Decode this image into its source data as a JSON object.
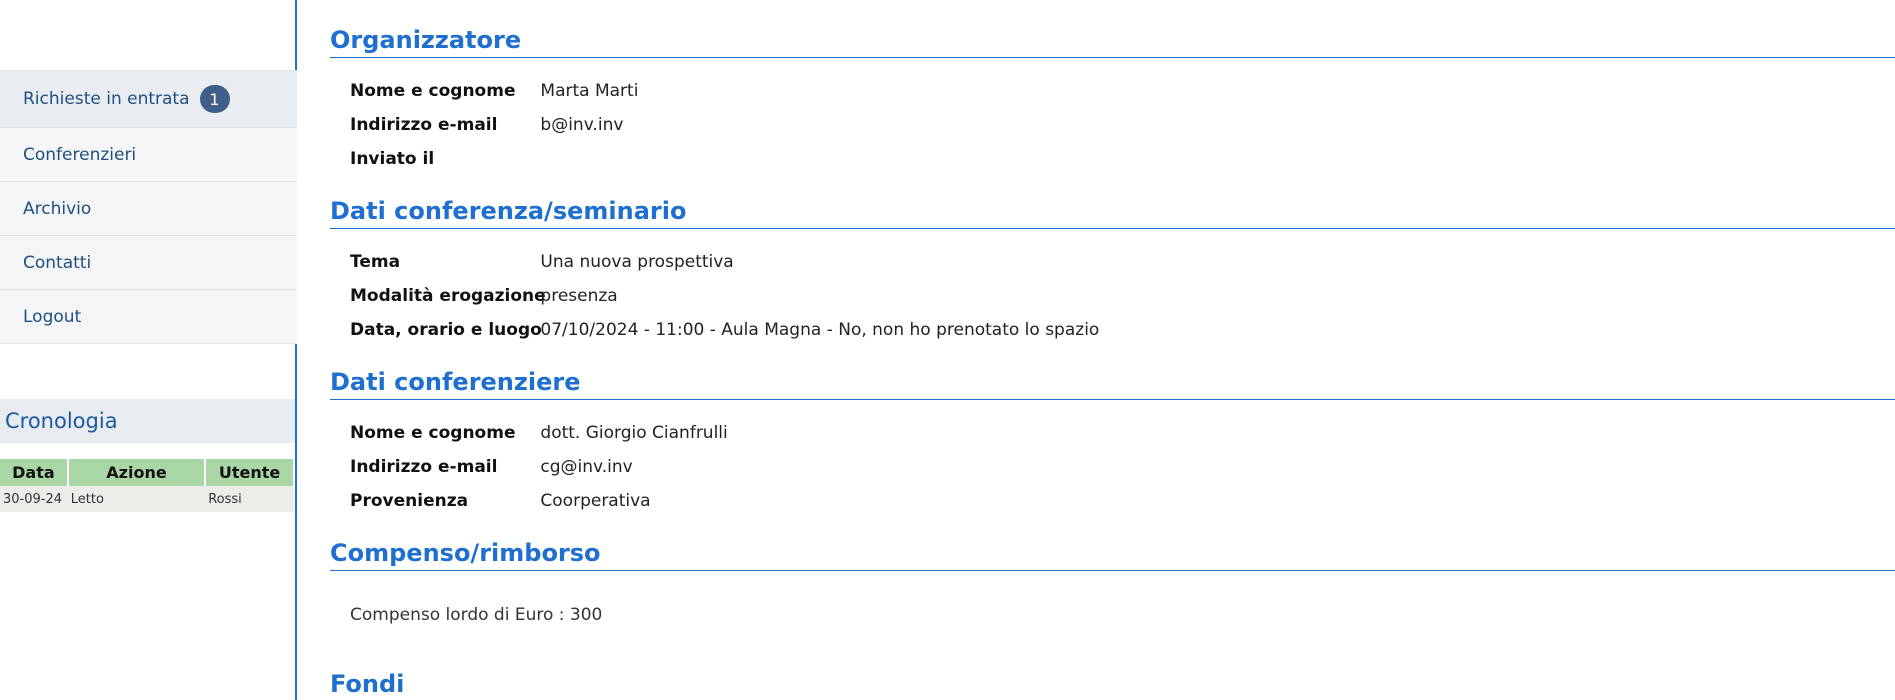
{
  "sidebar": {
    "nav": [
      {
        "label": "Richieste in entrata",
        "badge": "1"
      },
      {
        "label": "Conferenzieri"
      },
      {
        "label": "Archivio"
      },
      {
        "label": "Contatti"
      },
      {
        "label": "Logout"
      }
    ],
    "cronologia": {
      "title": "Cronologia",
      "headers": [
        "Data",
        "Azione",
        "Utente"
      ],
      "rows": [
        [
          "30-09-24",
          "Letto",
          "Rossi"
        ]
      ]
    }
  },
  "main": {
    "organizzatore": {
      "title": "Organizzatore",
      "fields": [
        {
          "label": "Nome e cognome",
          "value": "Marta Marti"
        },
        {
          "label": "Indirizzo e-mail",
          "value": "b@inv.inv"
        },
        {
          "label": "Inviato il",
          "value": ""
        }
      ]
    },
    "conferenza": {
      "title": "Dati conferenza/seminario",
      "fields": [
        {
          "label": "Tema",
          "value": "Una nuova prospettiva"
        },
        {
          "label": "Modalità erogazione",
          "value": "presenza"
        },
        {
          "label": "Data, orario e luogo",
          "value": "07/10/2024 - 11:00 - Aula Magna - No, non ho prenotato lo spazio"
        }
      ]
    },
    "conferenziere": {
      "title": "Dati conferenziere",
      "fields": [
        {
          "label": "Nome e cognome",
          "value": "dott. Giorgio Cianfrulli"
        },
        {
          "label": "Indirizzo e-mail",
          "value": "cg@inv.inv"
        },
        {
          "label": "Provenienza",
          "value": "Coorperativa"
        }
      ]
    },
    "compenso": {
      "title": "Compenso/rimborso",
      "text": "Compenso lordo di Euro : 300"
    },
    "fondi": {
      "title": "Fondi"
    }
  },
  "colors": {
    "accent": "#1e6fd0",
    "badge": "#3f5f8a",
    "table_header": "#a8d6a4"
  }
}
